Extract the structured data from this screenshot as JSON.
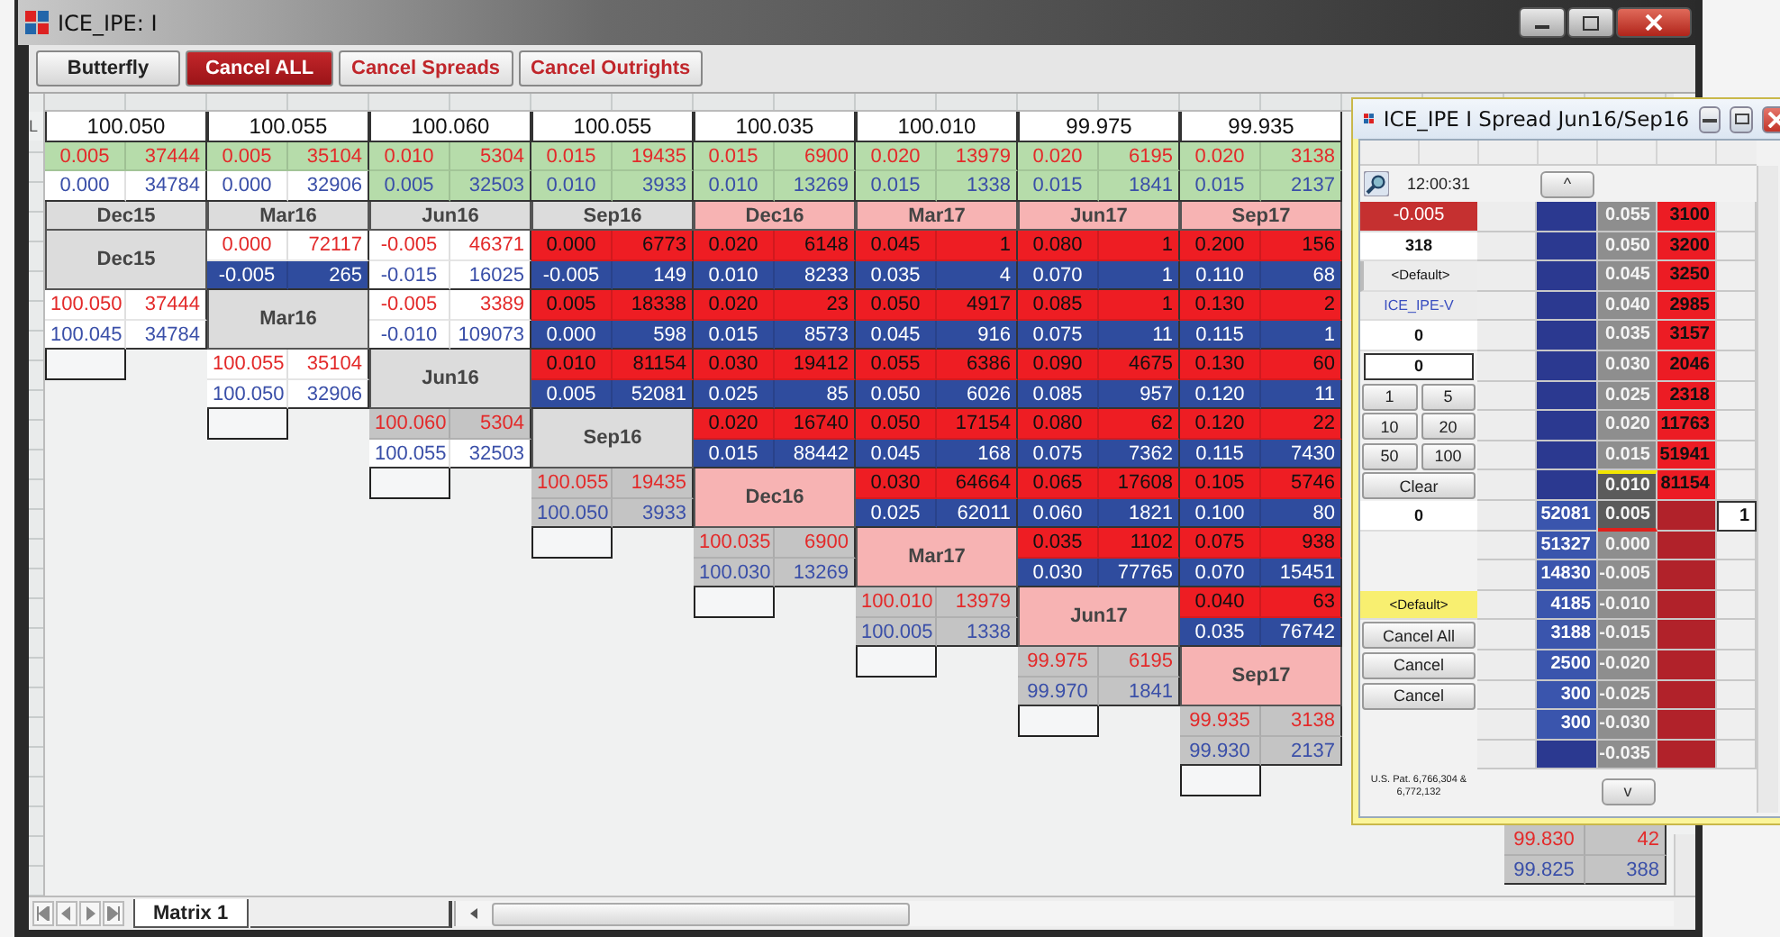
{
  "window": {
    "title": "ICE_IPE: I"
  },
  "toolbar": [
    {
      "label": "Butterfly",
      "kind": "plain"
    },
    {
      "label": "Cancel ALL",
      "kind": "alert"
    },
    {
      "label": "Cancel Spreads",
      "kind": "cancel"
    },
    {
      "label": "Cancel Outrights",
      "kind": "cancel"
    }
  ],
  "row_header": "L",
  "matrix": {
    "columns": [
      {
        "price": "100.050",
        "top": {
          "price": "0.005",
          "qty": "37444",
          "color": "#b6dcaa"
        },
        "bottom": {
          "price": "0.000",
          "qty": "34784",
          "color": "#ffffff"
        },
        "label": "Dec15",
        "color": "#dcdcdc"
      },
      {
        "price": "100.055",
        "top": {
          "price": "0.005",
          "qty": "35104",
          "color": "#b6dcaa"
        },
        "bottom": {
          "price": "0.000",
          "qty": "32906",
          "color": "#ffffff"
        },
        "label": "Mar16",
        "color": "#dcdcdc"
      },
      {
        "price": "100.060",
        "top": {
          "price": "0.010",
          "qty": "5304",
          "color": "#b6dcaa"
        },
        "bottom": {
          "price": "0.005",
          "qty": "32503",
          "color": "#b6dcaa"
        },
        "label": "Jun16",
        "color": "#dcdcdc"
      },
      {
        "price": "100.055",
        "top": {
          "price": "0.015",
          "qty": "19435",
          "color": "#b6dcaa"
        },
        "bottom": {
          "price": "0.010",
          "qty": "3933",
          "color": "#b6dcaa"
        },
        "label": "Sep16",
        "color": "#dcdcdc"
      },
      {
        "price": "100.035",
        "top": {
          "price": "0.015",
          "qty": "6900",
          "color": "#b6dcaa"
        },
        "bottom": {
          "price": "0.010",
          "qty": "13269",
          "color": "#b6dcaa"
        },
        "label": "Dec16",
        "color": "#f7b3b3"
      },
      {
        "price": "100.010",
        "top": {
          "price": "0.020",
          "qty": "13979",
          "color": "#b6dcaa"
        },
        "bottom": {
          "price": "0.015",
          "qty": "1338",
          "color": "#b6dcaa"
        },
        "label": "Mar17",
        "color": "#f7b3b3"
      },
      {
        "price": "99.975",
        "top": {
          "price": "0.020",
          "qty": "6195",
          "color": "#b6dcaa"
        },
        "bottom": {
          "price": "0.015",
          "qty": "1841",
          "color": "#b6dcaa"
        },
        "label": "Jun17",
        "color": "#f7b3b3"
      },
      {
        "price": "99.935",
        "top": {
          "price": "0.020",
          "qty": "3138",
          "color": "#b6dcaa"
        },
        "bottom": {
          "price": "0.015",
          "qty": "2137",
          "color": "#b6dcaa"
        },
        "label": "Sep17",
        "color": "#f7b3b3"
      }
    ],
    "blocks": [
      {
        "label": "Dec15",
        "empty_box": false,
        "spreads": [
          {
            "top": {
              "price": "0.000",
              "qty": "72117",
              "color": "#ffffff"
            },
            "bottom": {
              "price": "-0.005",
              "qty": "265",
              "color": "#2f4c9e"
            }
          },
          {
            "top": {
              "price": "-0.005",
              "qty": "46371",
              "color": "#ffffff"
            },
            "bottom": {
              "price": "-0.015",
              "qty": "16025",
              "color": "#ffffff"
            }
          },
          {
            "top": {
              "price": "0.000",
              "qty": "6773",
              "color": "#ee1d23"
            },
            "bottom": {
              "price": "-0.005",
              "qty": "149",
              "color": "#2f4c9e"
            }
          },
          {
            "top": {
              "price": "0.020",
              "qty": "6148",
              "color": "#ee1d23"
            },
            "bottom": {
              "price": "0.010",
              "qty": "8233",
              "color": "#2f4c9e"
            }
          },
          {
            "top": {
              "price": "0.045",
              "qty": "1",
              "color": "#ee1d23"
            },
            "bottom": {
              "price": "0.035",
              "qty": "4",
              "color": "#2f4c9e"
            }
          },
          {
            "top": {
              "price": "0.080",
              "qty": "1",
              "color": "#ee1d23"
            },
            "bottom": {
              "price": "0.070",
              "qty": "1",
              "color": "#2f4c9e"
            }
          },
          {
            "top": {
              "price": "0.200",
              "qty": "156",
              "color": "#ee1d23"
            },
            "bottom": {
              "price": "0.110",
              "qty": "68",
              "color": "#2f4c9e"
            }
          }
        ]
      },
      {
        "label": "Mar16",
        "empty_box": false,
        "outright": {
          "top": {
            "price": "100.050",
            "qty": "37444",
            "color": "#ffffff"
          },
          "bottom": {
            "price": "100.045",
            "qty": "34784",
            "color": "#ffffff"
          }
        },
        "spreads": [
          {
            "top": {
              "price": "-0.005",
              "qty": "3389",
              "color": "#ffffff"
            },
            "bottom": {
              "price": "-0.010",
              "qty": "109073",
              "color": "#ffffff"
            }
          },
          {
            "top": {
              "price": "0.005",
              "qty": "18338",
              "color": "#ee1d23"
            },
            "bottom": {
              "price": "0.000",
              "qty": "598",
              "color": "#2f4c9e"
            }
          },
          {
            "top": {
              "price": "0.020",
              "qty": "23",
              "color": "#ee1d23"
            },
            "bottom": {
              "price": "0.015",
              "qty": "8573",
              "color": "#2f4c9e"
            }
          },
          {
            "top": {
              "price": "0.050",
              "qty": "4917",
              "color": "#ee1d23"
            },
            "bottom": {
              "price": "0.045",
              "qty": "916",
              "color": "#2f4c9e"
            }
          },
          {
            "top": {
              "price": "0.085",
              "qty": "1",
              "color": "#ee1d23"
            },
            "bottom": {
              "price": "0.075",
              "qty": "11",
              "color": "#2f4c9e"
            }
          },
          {
            "top": {
              "price": "0.130",
              "qty": "2",
              "color": "#ee1d23"
            },
            "bottom": {
              "price": "0.115",
              "qty": "1",
              "color": "#2f4c9e"
            }
          }
        ]
      },
      {
        "label": "Jun16",
        "empty_box": true,
        "outright": {
          "top": {
            "price": "100.055",
            "qty": "35104",
            "color": "#ffffff"
          },
          "bottom": {
            "price": "100.050",
            "qty": "32906",
            "color": "#ffffff"
          }
        },
        "spreads": [
          {
            "top": {
              "price": "0.010",
              "qty": "81154",
              "color": "#ee1d23"
            },
            "bottom": {
              "price": "0.005",
              "qty": "52081",
              "color": "#2f4c9e"
            }
          },
          {
            "top": {
              "price": "0.030",
              "qty": "19412",
              "color": "#ee1d23"
            },
            "bottom": {
              "price": "0.025",
              "qty": "85",
              "color": "#2f4c9e"
            }
          },
          {
            "top": {
              "price": "0.055",
              "qty": "6386",
              "color": "#ee1d23"
            },
            "bottom": {
              "price": "0.050",
              "qty": "6026",
              "color": "#2f4c9e"
            }
          },
          {
            "top": {
              "price": "0.090",
              "qty": "4675",
              "color": "#ee1d23"
            },
            "bottom": {
              "price": "0.085",
              "qty": "957",
              "color": "#2f4c9e"
            }
          },
          {
            "top": {
              "price": "0.130",
              "qty": "60",
              "color": "#ee1d23"
            },
            "bottom": {
              "price": "0.120",
              "qty": "11",
              "color": "#2f4c9e"
            }
          }
        ]
      },
      {
        "label": "Sep16",
        "empty_box": true,
        "outright": {
          "top": {
            "price": "100.060",
            "qty": "5304",
            "color": "#c4c4c4"
          },
          "bottom": {
            "price": "100.055",
            "qty": "32503",
            "color": "#ffffff"
          }
        },
        "spreads": [
          {
            "top": {
              "price": "0.020",
              "qty": "16740",
              "color": "#ee1d23"
            },
            "bottom": {
              "price": "0.015",
              "qty": "88442",
              "color": "#2f4c9e"
            }
          },
          {
            "top": {
              "price": "0.050",
              "qty": "17154",
              "color": "#ee1d23"
            },
            "bottom": {
              "price": "0.045",
              "qty": "168",
              "color": "#2f4c9e"
            }
          },
          {
            "top": {
              "price": "0.080",
              "qty": "62",
              "color": "#ee1d23"
            },
            "bottom": {
              "price": "0.075",
              "qty": "7362",
              "color": "#2f4c9e"
            }
          },
          {
            "top": {
              "price": "0.120",
              "qty": "22",
              "color": "#ee1d23"
            },
            "bottom": {
              "price": "0.115",
              "qty": "7430",
              "color": "#2f4c9e"
            }
          }
        ]
      },
      {
        "label": "Dec16",
        "empty_box": true,
        "outright": {
          "top": {
            "price": "100.055",
            "qty": "19435",
            "color": "#c4c4c4"
          },
          "bottom": {
            "price": "100.050",
            "qty": "3933",
            "color": "#c4c4c4"
          }
        },
        "spreads": [
          {
            "top": {
              "price": "0.030",
              "qty": "64664",
              "color": "#ee1d23"
            },
            "bottom": {
              "price": "0.025",
              "qty": "62011",
              "color": "#2f4c9e"
            }
          },
          {
            "top": {
              "price": "0.065",
              "qty": "17608",
              "color": "#ee1d23"
            },
            "bottom": {
              "price": "0.060",
              "qty": "1821",
              "color": "#2f4c9e"
            }
          },
          {
            "top": {
              "price": "0.105",
              "qty": "5746",
              "color": "#ee1d23"
            },
            "bottom": {
              "price": "0.100",
              "qty": "80",
              "color": "#2f4c9e"
            }
          }
        ]
      },
      {
        "label": "Mar17",
        "empty_box": true,
        "outright": {
          "top": {
            "price": "100.035",
            "qty": "6900",
            "color": "#c4c4c4"
          },
          "bottom": {
            "price": "100.030",
            "qty": "13269",
            "color": "#c4c4c4"
          }
        },
        "spreads": [
          {
            "top": {
              "price": "0.035",
              "qty": "1102",
              "color": "#ee1d23"
            },
            "bottom": {
              "price": "0.030",
              "qty": "77765",
              "color": "#2f4c9e"
            }
          },
          {
            "top": {
              "price": "0.075",
              "qty": "938",
              "color": "#ee1d23"
            },
            "bottom": {
              "price": "0.070",
              "qty": "15451",
              "color": "#2f4c9e"
            }
          }
        ]
      },
      {
        "label": "Jun17",
        "empty_box": true,
        "outright": {
          "top": {
            "price": "100.010",
            "qty": "13979",
            "color": "#c4c4c4"
          },
          "bottom": {
            "price": "100.005",
            "qty": "1338",
            "color": "#c4c4c4"
          }
        },
        "spreads": [
          {
            "top": {
              "price": "0.040",
              "qty": "63",
              "color": "#ee1d23"
            },
            "bottom": {
              "price": "0.035",
              "qty": "76742",
              "color": "#2f4c9e"
            }
          }
        ]
      },
      {
        "label": "Sep17",
        "empty_box": true,
        "outright": {
          "top": {
            "price": "99.975",
            "qty": "6195",
            "color": "#c4c4c4"
          },
          "bottom": {
            "price": "99.970",
            "qty": "1841",
            "color": "#c4c4c4"
          }
        }
      },
      {
        "empty_box": true,
        "outright": {
          "top": {
            "price": "99.935",
            "qty": "3138",
            "color": "#c4c4c4"
          },
          "bottom": {
            "price": "99.930",
            "qty": "2137",
            "color": "#c4c4c4"
          }
        }
      },
      {
        "empty_box": true
      },
      {
        "empty_box": false,
        "outright": {
          "top": {
            "price": "99.830",
            "qty": "42",
            "color": "#c4c4c4"
          },
          "bottom": {
            "price": "99.825",
            "qty": "388",
            "color": "#c4c4c4"
          }
        }
      }
    ]
  },
  "sheet_tabs": [
    {
      "label": "Matrix 1",
      "selected": true
    }
  ],
  "spread_window": {
    "title": "ICE_IPE I Spread Jun16/Sep16",
    "time": "12:00:31",
    "up": "^",
    "down": "v",
    "order_panel": [
      {
        "kind": "price",
        "text": "-0.005"
      },
      {
        "kind": "value",
        "text": "318"
      },
      {
        "kind": "dropdown",
        "text": "<Default>"
      },
      {
        "kind": "account",
        "text": "ICE_IPE-V"
      },
      {
        "kind": "value",
        "text": "0"
      },
      {
        "kind": "input",
        "text": "0"
      },
      {
        "kind": "pair",
        "labels": [
          "1",
          "5"
        ]
      },
      {
        "kind": "pair",
        "labels": [
          "10",
          "20"
        ]
      },
      {
        "kind": "pair",
        "labels": [
          "50",
          "100"
        ]
      },
      {
        "kind": "button",
        "text": "Clear"
      },
      {
        "kind": "value",
        "text": "0"
      },
      {
        "kind": "blank"
      },
      {
        "kind": "blank"
      },
      {
        "kind": "highlight",
        "text": "<Default>"
      },
      {
        "kind": "button",
        "text": "Cancel All"
      },
      {
        "kind": "button",
        "text": "Cancel"
      },
      {
        "kind": "button",
        "text": "Cancel"
      }
    ],
    "patent": "U.S. Pat. 6,766,304 & 6,772,132",
    "ladder": [
      {
        "price": "0.055",
        "ask": "3100",
        "best_ask": false,
        "best_bid": false
      },
      {
        "price": "0.050",
        "ask": "3200",
        "best_ask": false,
        "best_bid": false
      },
      {
        "price": "0.045",
        "ask": "3250",
        "best_ask": false,
        "best_bid": false
      },
      {
        "price": "0.040",
        "ask": "2985",
        "best_ask": false,
        "best_bid": false
      },
      {
        "price": "0.035",
        "ask": "3157",
        "best_ask": false,
        "best_bid": false
      },
      {
        "price": "0.030",
        "ask": "2046",
        "best_ask": false,
        "best_bid": false
      },
      {
        "price": "0.025",
        "ask": "2318",
        "best_ask": false,
        "best_bid": false
      },
      {
        "price": "0.020",
        "ask": "11763",
        "best_ask": false,
        "best_bid": false
      },
      {
        "price": "0.015",
        "ask": "51941",
        "best_ask": false,
        "best_bid": false
      },
      {
        "price": "0.010",
        "ask": "81154",
        "best_ask": true,
        "best_bid": false
      },
      {
        "price": "0.005",
        "bid": "52081",
        "last": "1",
        "best_ask": false,
        "best_bid": true
      },
      {
        "price": "0.000",
        "bid": "51327",
        "best_ask": false,
        "best_bid": false
      },
      {
        "price": "-0.005",
        "bid": "14830",
        "best_ask": false,
        "best_bid": false
      },
      {
        "price": "-0.010",
        "bid": "4185",
        "best_ask": false,
        "best_bid": false
      },
      {
        "price": "-0.015",
        "bid": "3188",
        "best_ask": false,
        "best_bid": false
      },
      {
        "price": "-0.020",
        "bid": "2500",
        "best_ask": false,
        "best_bid": false
      },
      {
        "price": "-0.025",
        "bid": "300",
        "best_ask": false,
        "best_bid": false
      },
      {
        "price": "-0.030",
        "bid": "300",
        "best_ask": false,
        "best_bid": false
      },
      {
        "price": "-0.035",
        "best_ask": false,
        "best_bid": false
      }
    ]
  }
}
